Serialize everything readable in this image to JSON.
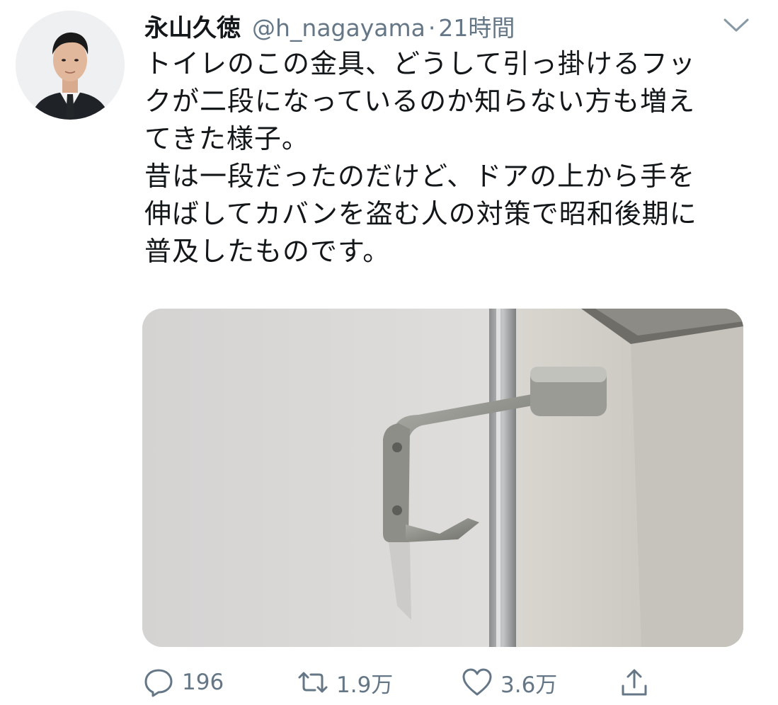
{
  "user": {
    "name": "永山久徳",
    "handle": "@h_nagayama",
    "separator": "·",
    "time": "21時間"
  },
  "tweet": {
    "lines": [
      "トイレのこの金具、どうして引っ掛けるフッ",
      "クが二段になっているのか知らない方も増え",
      "てきた様子。",
      "昔は一段だったのだけど、ドアの上から手を",
      "伸ばしてカバンを盗む人の対策で昭和後期に",
      "普及したものです。"
    ]
  },
  "actions": {
    "reply_count": "196",
    "retweet_count": "1.9万",
    "like_count": "3.6万"
  },
  "icons": {
    "caret": "chevron-down-icon",
    "reply": "speech-bubble-icon",
    "retweet": "retweet-arrows-icon",
    "like": "heart-outline-icon",
    "share": "share-upload-icon"
  },
  "colors": {
    "text": "#14171a",
    "secondary": "#657786"
  }
}
